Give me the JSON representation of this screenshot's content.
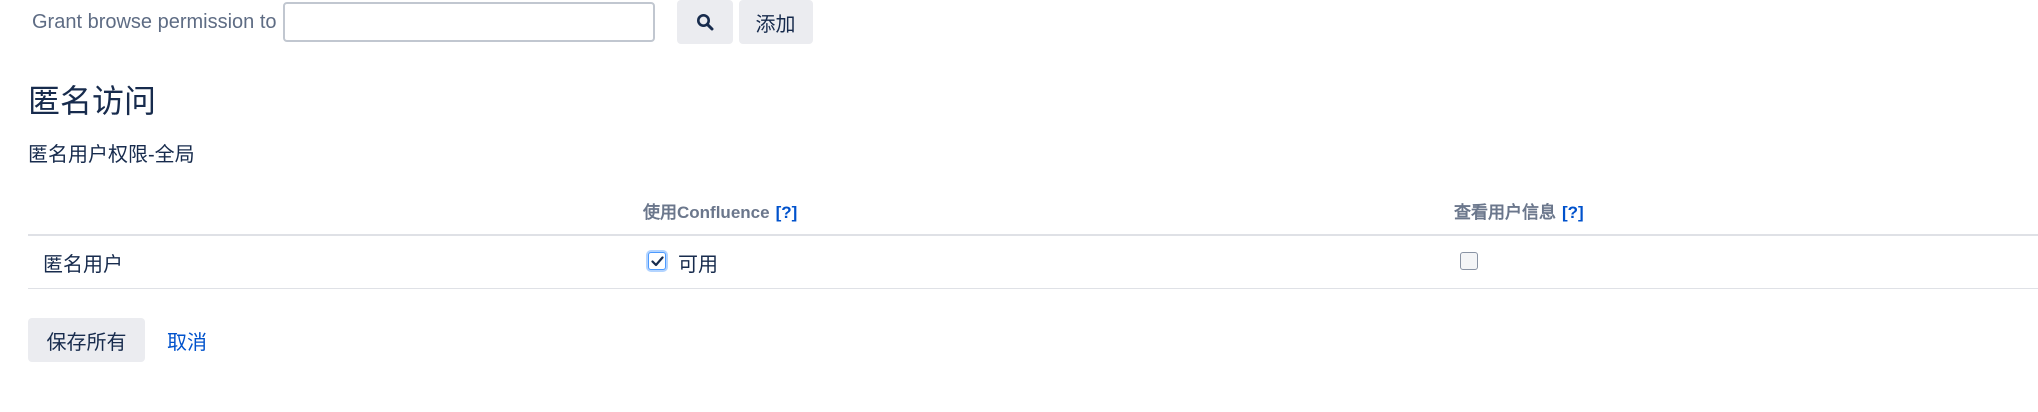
{
  "grant": {
    "label": "Grant browse permission to",
    "input_value": "",
    "input_placeholder": "",
    "search_icon": "search-icon",
    "add_label": "添加"
  },
  "section": {
    "title": "匿名访问",
    "subtitle": "匿名用户权限-全局"
  },
  "table": {
    "columns": [
      {
        "label": "使用Confluence",
        "help": "[?]"
      },
      {
        "label": "查看用户信息",
        "help": "[?]"
      }
    ],
    "rows": [
      {
        "label": "匿名用户",
        "use_confluence_checked": true,
        "use_confluence_text": "可用",
        "view_user_profiles_checked": false
      }
    ]
  },
  "actions": {
    "save_label": "保存所有",
    "cancel_label": "取消"
  },
  "colors": {
    "link": "#0052cc",
    "button_bg": "#ebecf0",
    "text": "#172b4d",
    "muted_text": "#5e6c84",
    "border": "#dfe1e6"
  }
}
